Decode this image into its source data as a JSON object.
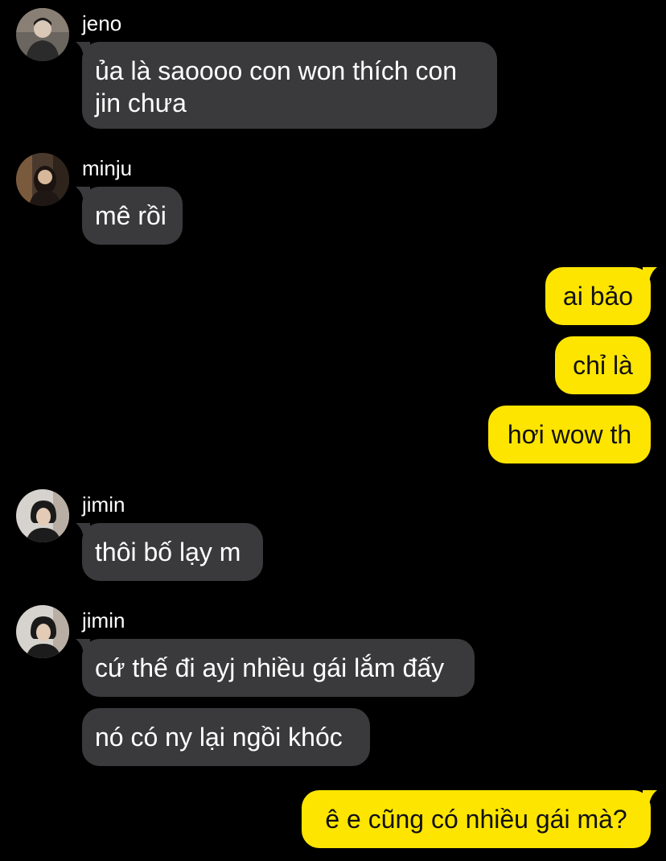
{
  "colors": {
    "background": "#000000",
    "incoming_bubble": "#3a3a3c",
    "outgoing_bubble": "#fee500",
    "incoming_text": "#ffffff",
    "outgoing_text": "#111111"
  },
  "messages": [
    {
      "sender": "jeno",
      "avatar_icon": "profile-photo-icon",
      "text": "ủa là saoooo con won thích con jin chưa"
    },
    {
      "sender": "minju",
      "avatar_icon": "profile-photo-icon",
      "text": "mê rồi"
    },
    {
      "outgoing": [
        "ai bảo",
        "chỉ là",
        "hơi wow th"
      ]
    },
    {
      "sender": "jimin",
      "avatar_icon": "profile-photo-icon",
      "text": "thôi bố lạy m"
    },
    {
      "sender": "jimin",
      "avatar_icon": "profile-photo-icon",
      "texts": [
        "cứ thế đi ayj nhiều gái lắm đấy",
        "nó có ny lại ngồi khóc"
      ]
    },
    {
      "outgoing": [
        "ê e cũng có nhiều gái mà?"
      ]
    }
  ]
}
